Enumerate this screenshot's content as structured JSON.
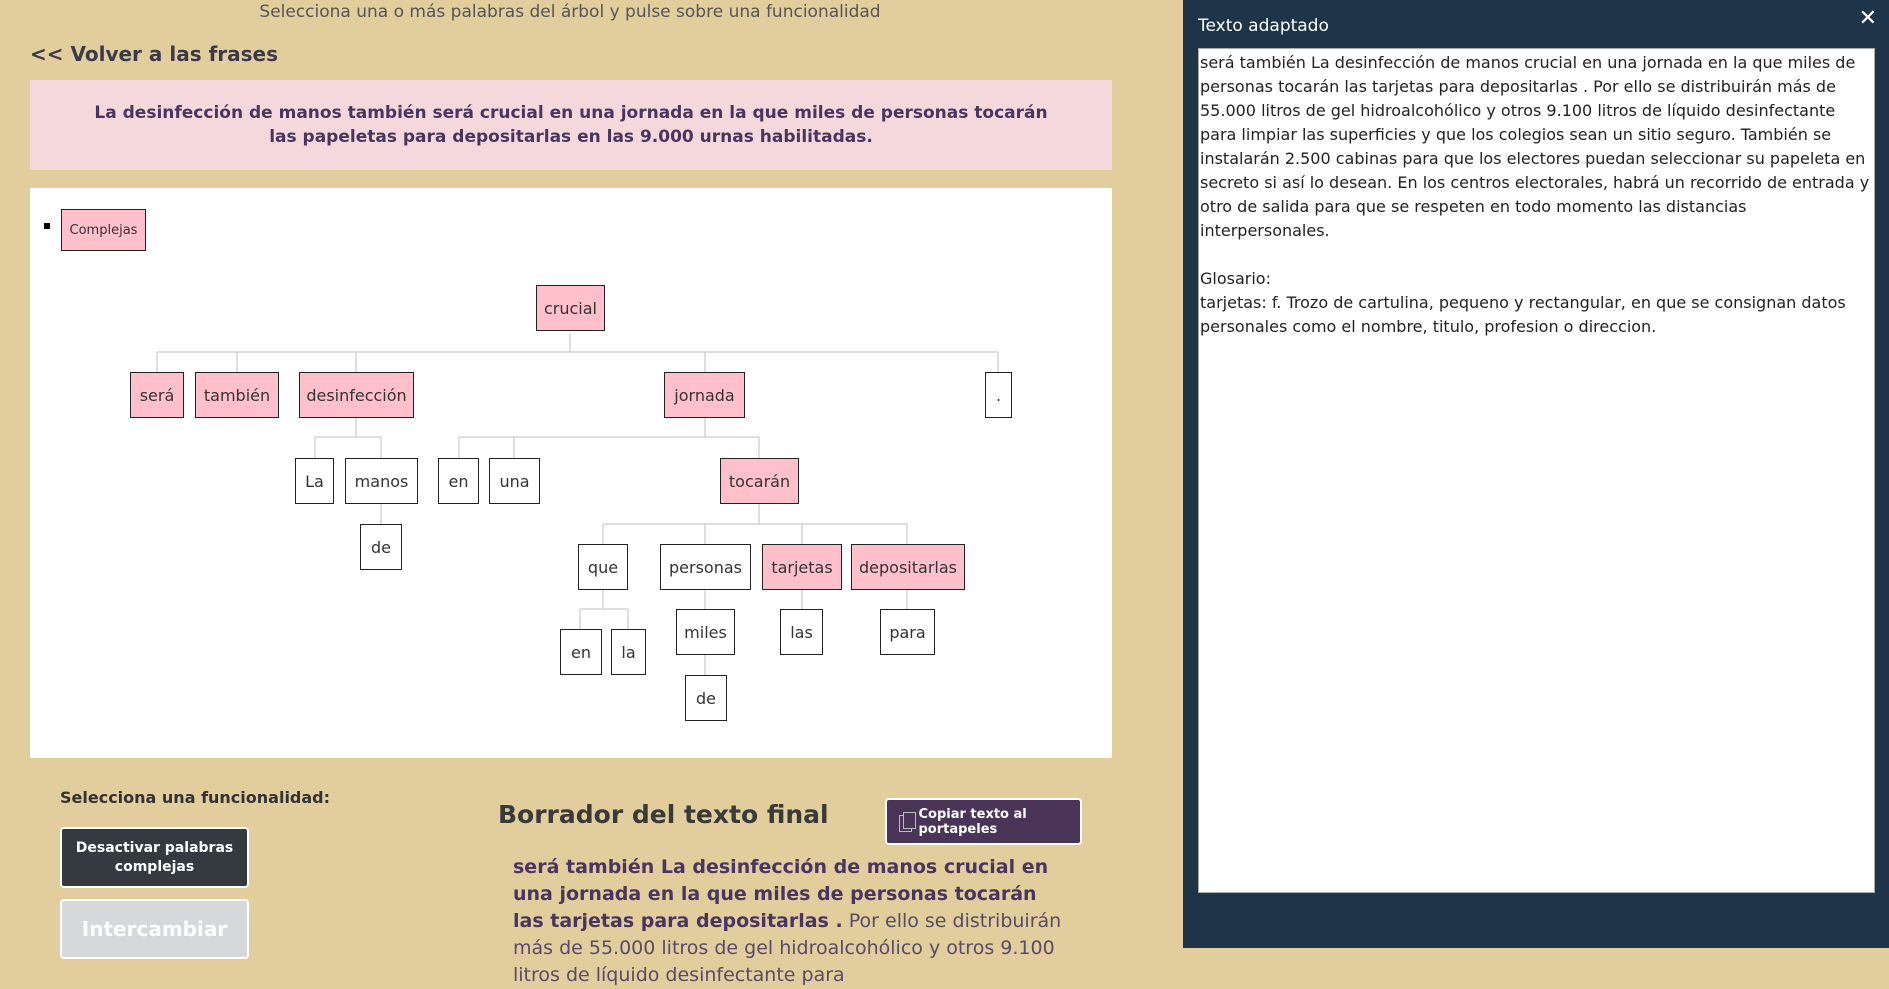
{
  "instruction": "Selecciona una o más palabras del árbol y pulse sobre una funcionalidad",
  "back_link": "<< Volver a las frases",
  "sentence": "La desinfección de manos también será crucial en una jornada en la que miles de personas tocarán las papeletas para depositarlas en las 9.000 urnas habilitadas.",
  "tree": {
    "legend": "Complejas",
    "words": {
      "crucial": "crucial",
      "sera": "será",
      "tambien": "también",
      "desinfeccion": "desinfección",
      "jornada": "jornada",
      "punto": ".",
      "la": "La",
      "manos": "manos",
      "de1": "de",
      "en1": "en",
      "una": "una",
      "tocaran": "tocarán",
      "que": "que",
      "personas": "personas",
      "tarjetas": "tarjetas",
      "depositarlas": "depositarlas",
      "en2": "en",
      "la2": "la",
      "miles": "miles",
      "las": "las",
      "para": "para",
      "de2": "de"
    }
  },
  "functions": {
    "title": "Selecciona una funcionalidad:",
    "deactivate": "Desactivar palabras complejas",
    "swap": "Intercambiar"
  },
  "draft": {
    "title": "Borrador del texto final",
    "copy_button": "Copiar texto al portapeles",
    "bold_text": "será también La desinfección de manos crucial en una jornada en la que miles de personas tocarán las tarjetas para depositarlas .",
    "rest_text": " Por ello se distribuirán más de 55.000 litros de gel hidroalcohólico y otros 9.100 litros de líquido desinfectante para"
  },
  "adapted": {
    "title": "Texto adaptado",
    "close": "✕",
    "text": "será también La desinfección de manos crucial en una jornada en la que miles de personas tocarán las tarjetas para depositarlas . Por ello se distribuirán más de 55.000 litros de gel hidroalcohólico y otros 9.100 litros de líquido desinfectante para limpiar las superficies y que los colegios sean un sitio seguro. También se instalarán 2.500 cabinas para que los electores puedan seleccionar su papeleta en secreto si así lo desean. En los centros electorales, habrá un recorrido de entrada y otro de salida para que se respeten en todo momento las distancias interpersonales.\n\nGlosario:\ntarjetas: f. Trozo de cartulina, pequeno y rectangular, en que se consignan datos personales como el nombre, titulo, profesion o direccion."
  },
  "colors": {
    "page_bg": "#e2cd9c",
    "sentence_bg": "#f5d8dc",
    "complex_word": "#ffc0cb",
    "panel_bg": "#1e3449",
    "dark_button": "#343a40",
    "copy_button": "#4a3558"
  }
}
